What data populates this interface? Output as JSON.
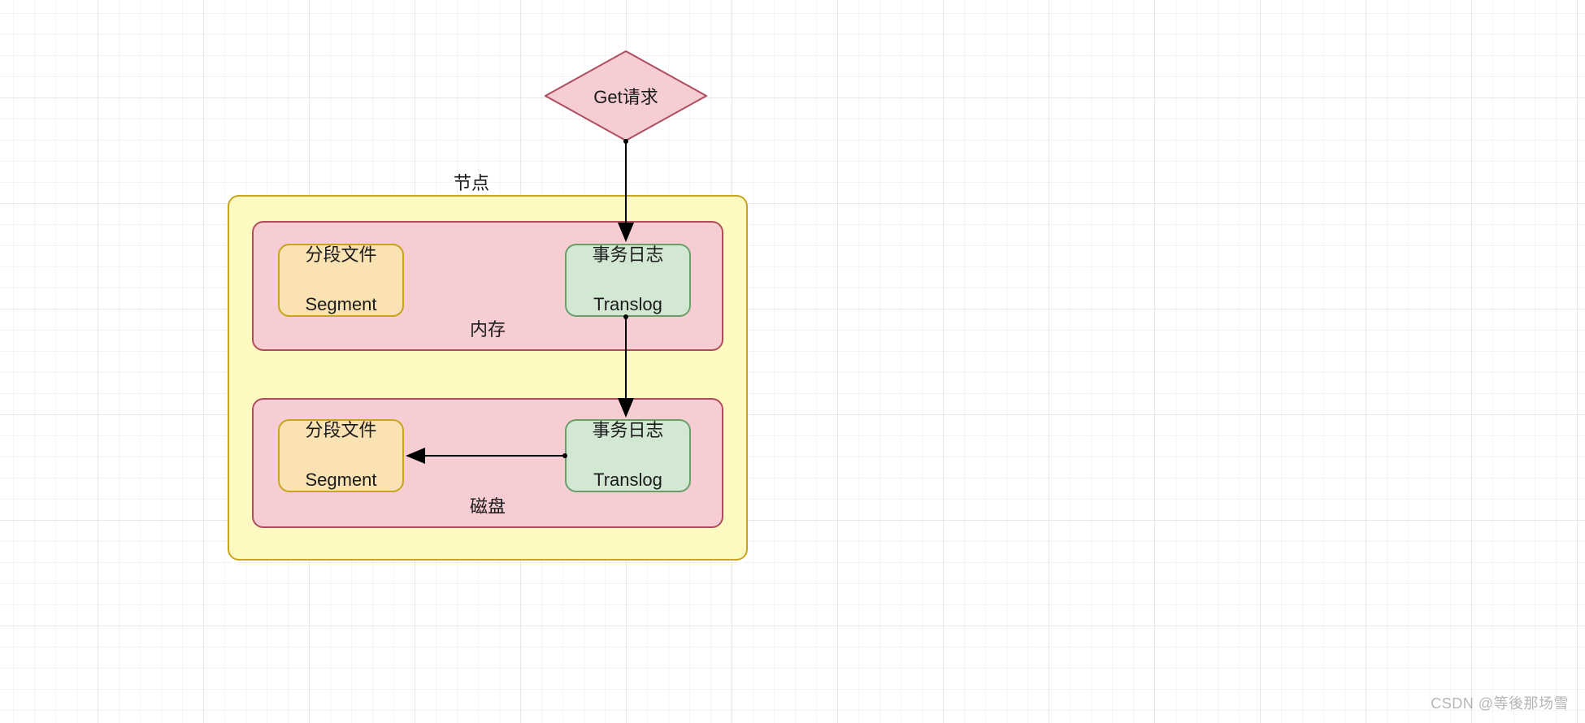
{
  "diamond": {
    "label": "Get请求"
  },
  "node": {
    "label": "节点"
  },
  "memory": {
    "label": "内存",
    "segment": {
      "line1": "分段文件",
      "line2": "Segment"
    },
    "translog": {
      "line1": "事务日志",
      "line2": "Translog"
    }
  },
  "disk": {
    "label": "磁盘",
    "segment": {
      "line1": "分段文件",
      "line2": "Segment"
    },
    "translog": {
      "line1": "事务日志",
      "line2": "Translog"
    }
  },
  "watermark": "CSDN @等後那场雪",
  "colors": {
    "grid_major": "#e8e8e8",
    "grid_minor": "#f4f4f4",
    "node_fill": "#fdfac1",
    "node_border": "#c8a41f",
    "zone_fill": "#f6cdd3",
    "zone_border": "#ae4d5d",
    "segment_fill": "#fbe2b3",
    "segment_border": "#c8a41f",
    "translog_fill": "#d3e8d3",
    "translog_border": "#6b9d6b",
    "diamond_fill": "#f6cdd3",
    "diamond_border": "#ae4d5d",
    "arrow": "#000000"
  }
}
